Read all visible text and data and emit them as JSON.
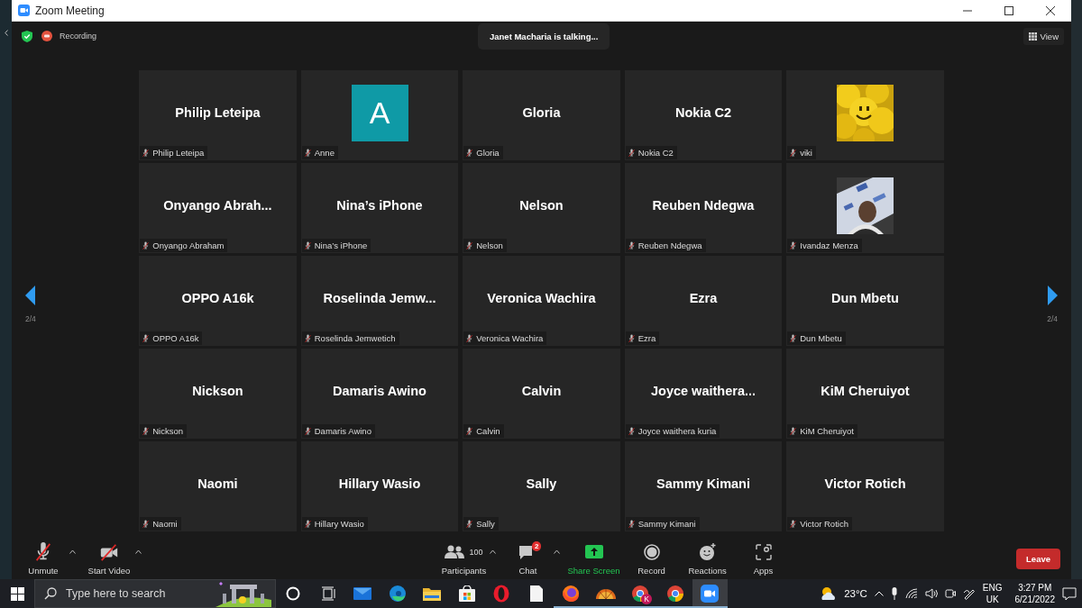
{
  "window": {
    "title": "Zoom Meeting"
  },
  "top_bar": {
    "recording_label": "Recording",
    "speaker_toast": "Janet Macharia is talking...",
    "view_button": "View"
  },
  "pager": {
    "left": "2/4",
    "right": "2/4"
  },
  "tiles": [
    {
      "kind": "name",
      "display_name": "Philip Leteipa",
      "label": "Philip Leteipa",
      "muted": true
    },
    {
      "kind": "letter",
      "letter": "A",
      "label": "Anne",
      "muted": true
    },
    {
      "kind": "name",
      "display_name": "Gloria",
      "label": "Gloria",
      "muted": true
    },
    {
      "kind": "name",
      "display_name": "Nokia C2",
      "label": "Nokia C2",
      "muted": true
    },
    {
      "kind": "picture",
      "label": "viki",
      "muted": true
    },
    {
      "kind": "name",
      "display_name": "Onyango Abrah...",
      "label": "Onyango Abraham",
      "muted": true
    },
    {
      "kind": "name",
      "display_name": "Nina’s iPhone",
      "label": "Nina’s iPhone",
      "muted": true
    },
    {
      "kind": "name",
      "display_name": "Nelson",
      "label": "Nelson",
      "muted": true
    },
    {
      "kind": "name",
      "display_name": "Reuben Ndegwa",
      "label": "Reuben Ndegwa",
      "muted": true
    },
    {
      "kind": "picture",
      "label": "Ivandaz Menza",
      "muted": true
    },
    {
      "kind": "name",
      "display_name": "OPPO A16k",
      "label": "OPPO A16k",
      "muted": true
    },
    {
      "kind": "name",
      "display_name": "Roselinda Jemw...",
      "label": "Roselinda Jemwetich",
      "muted": true
    },
    {
      "kind": "name",
      "display_name": "Veronica Wachira",
      "label": "Veronica Wachira",
      "muted": true
    },
    {
      "kind": "name",
      "display_name": "Ezra",
      "label": "Ezra",
      "muted": true
    },
    {
      "kind": "name",
      "display_name": "Dun Mbetu",
      "label": "Dun Mbetu",
      "muted": true
    },
    {
      "kind": "name",
      "display_name": "Nickson",
      "label": "Nickson",
      "muted": true
    },
    {
      "kind": "name",
      "display_name": "Damaris Awino",
      "label": "Damaris Awino",
      "muted": true
    },
    {
      "kind": "name",
      "display_name": "Calvin",
      "label": "Calvin",
      "muted": true
    },
    {
      "kind": "name",
      "display_name": "Joyce waithera...",
      "label": "Joyce waithera kuria",
      "muted": true
    },
    {
      "kind": "name",
      "display_name": "KiM Cheruiyot",
      "label": "KiM Cheruiyot",
      "muted": true
    },
    {
      "kind": "name",
      "display_name": "Naomi",
      "label": "Naomi",
      "muted": true
    },
    {
      "kind": "name",
      "display_name": "Hillary Wasio",
      "label": "Hillary Wasio",
      "muted": true
    },
    {
      "kind": "name",
      "display_name": "Sally",
      "label": "Sally",
      "muted": true
    },
    {
      "kind": "name",
      "display_name": "Sammy Kimani",
      "label": "Sammy Kimani",
      "muted": true
    },
    {
      "kind": "name",
      "display_name": "Victor Rotich",
      "label": "Victor Rotich",
      "muted": true
    }
  ],
  "toolbar": {
    "left": [
      {
        "kind": "mic",
        "label": "Unmute",
        "muted": true
      },
      {
        "kind": "video",
        "label": "Start Video",
        "muted": true
      }
    ],
    "center": [
      {
        "kind": "participants",
        "label": "Participants",
        "count": "100"
      },
      {
        "kind": "chat",
        "label": "Chat",
        "badge": "2"
      },
      {
        "kind": "share",
        "label": "Share Screen"
      },
      {
        "kind": "record",
        "label": "Record"
      },
      {
        "kind": "reactions",
        "label": "Reactions"
      },
      {
        "kind": "apps",
        "label": "Apps"
      }
    ],
    "leave_button": "Leave"
  },
  "taskbar": {
    "search_placeholder": "Type here to search",
    "apps": [
      {
        "kind": "cortana",
        "running": false,
        "selected": false
      },
      {
        "kind": "taskview",
        "running": false,
        "selected": false
      },
      {
        "kind": "mail",
        "running": false,
        "selected": false
      },
      {
        "kind": "edge",
        "running": false,
        "selected": false
      },
      {
        "kind": "folder",
        "running": false,
        "selected": false
      },
      {
        "kind": "store",
        "running": false,
        "selected": false
      },
      {
        "kind": "opera",
        "running": false,
        "selected": false
      },
      {
        "kind": "document",
        "running": false,
        "selected": false
      },
      {
        "kind": "firefox",
        "running": true,
        "selected": false
      },
      {
        "kind": "fan",
        "running": true,
        "selected": false
      },
      {
        "kind": "chrome",
        "badge": "K",
        "running": true,
        "selected": false
      },
      {
        "kind": "chrome",
        "running": true,
        "selected": false
      },
      {
        "kind": "zoom",
        "running": true,
        "selected": true
      }
    ],
    "temperature": "23°C",
    "language": "ENG",
    "region": "UK",
    "time": "3:27 PM",
    "date": "6/21/2022"
  }
}
